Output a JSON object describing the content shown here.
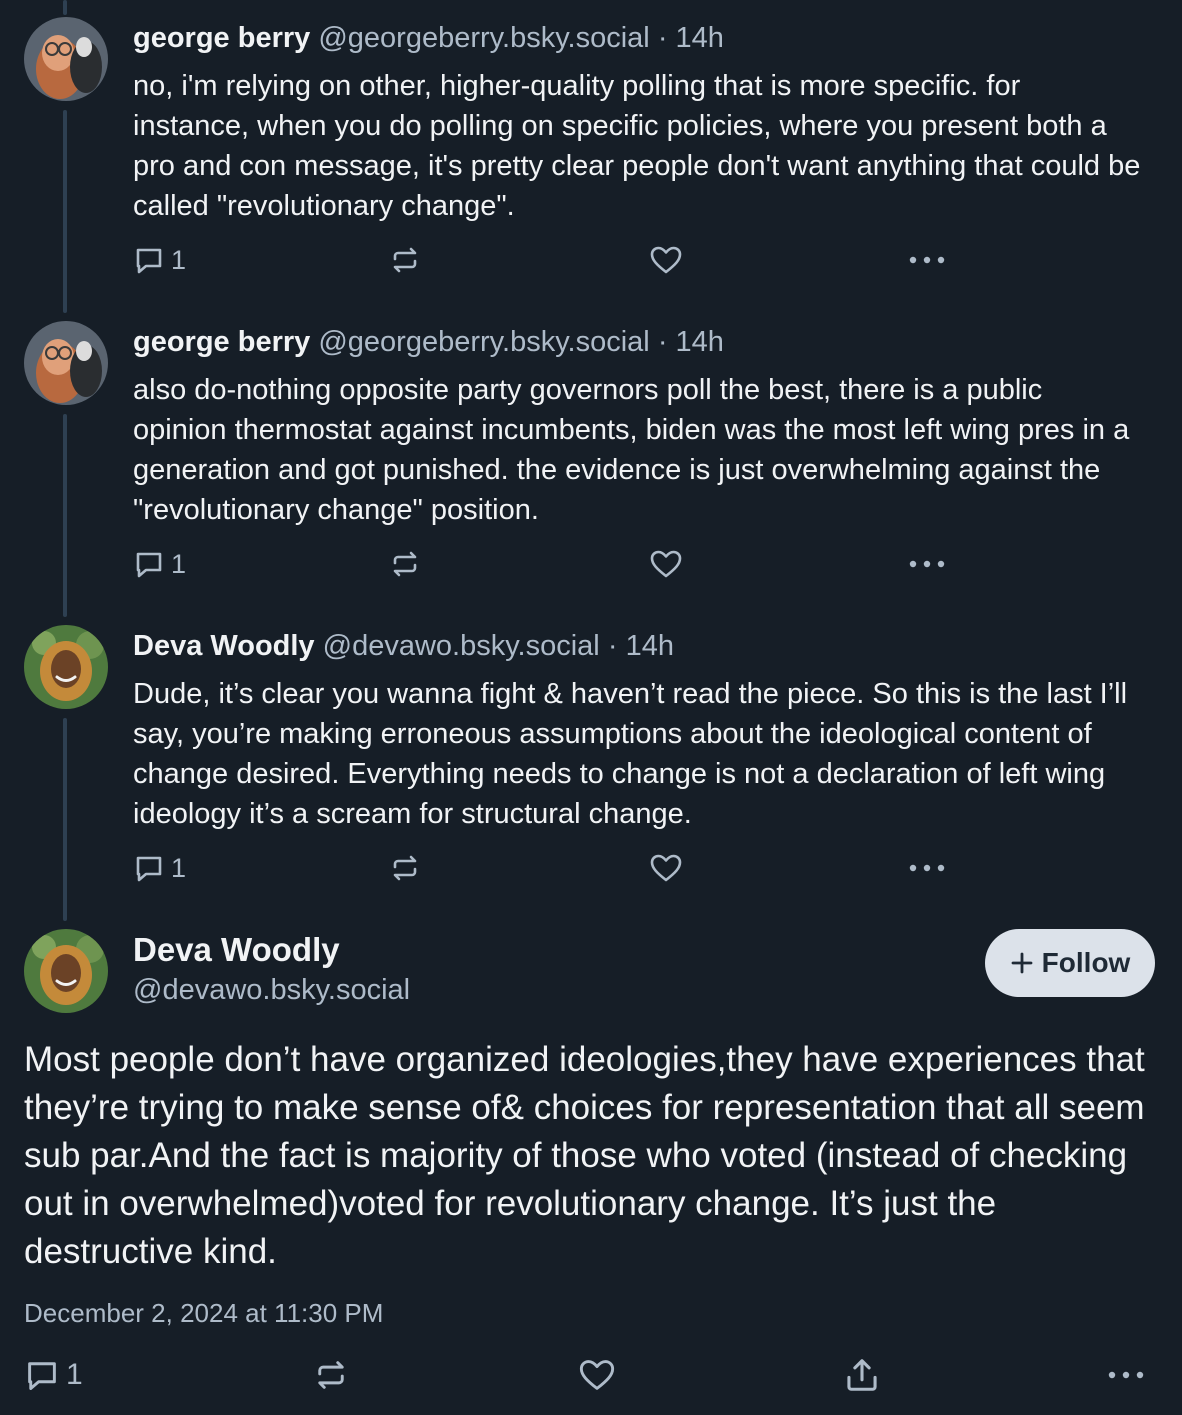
{
  "replies": [
    {
      "name": "george berry",
      "handle": "@georgeberry.bsky.social",
      "separator": "·",
      "time": "14h",
      "text": "no, i'm relying on other, higher-quality polling that is more specific. for instance, when you do polling on specific policies, where you present both a pro and con message, it's pretty clear people don't want anything that could be called \"revolutionary change\".",
      "reply_count": "1"
    },
    {
      "name": "george berry",
      "handle": "@georgeberry.bsky.social",
      "separator": "·",
      "time": "14h",
      "text": "also do-nothing opposite party governors poll the best, there is a public opinion thermostat against incumbents, biden was the most left wing pres in a generation and got punished. the evidence is just overwhelming against the \"revolutionary change\" position.",
      "reply_count": "1"
    },
    {
      "name": "Deva Woodly",
      "handle": "@devawo.bsky.social",
      "separator": "·",
      "time": "14h",
      "text": "Dude, it’s clear you wanna fight & haven’t read the piece. So this is the last I’ll say, you’re making erroneous assumptions about the ideological content of change desired. Everything needs to change is not a declaration of left wing ideology it’s a scream for structural change.",
      "reply_count": "1"
    }
  ],
  "main_post": {
    "name": "Deva Woodly",
    "handle": "@devawo.bsky.social",
    "follow_label": "Follow",
    "text": "Most people don’t have organized ideologies,they have experiences that they’re trying to make sense of& choices for representation that all seem sub par.And the fact is majority of those who voted (instead of checking out in overwhelmed)voted for revolutionary change. It’s just the destructive kind.",
    "date": "December 2, 2024 at 11:30 PM",
    "reply_count": "1"
  },
  "colors": {
    "background": "#161e27",
    "text": "#f1f3f5",
    "muted": "#aebbc9",
    "thread_line": "#2e4052",
    "follow_button": "#dce2ea"
  },
  "icons": [
    "reply-icon",
    "repost-icon",
    "like-icon",
    "more-icon",
    "share-icon",
    "plus-icon"
  ]
}
